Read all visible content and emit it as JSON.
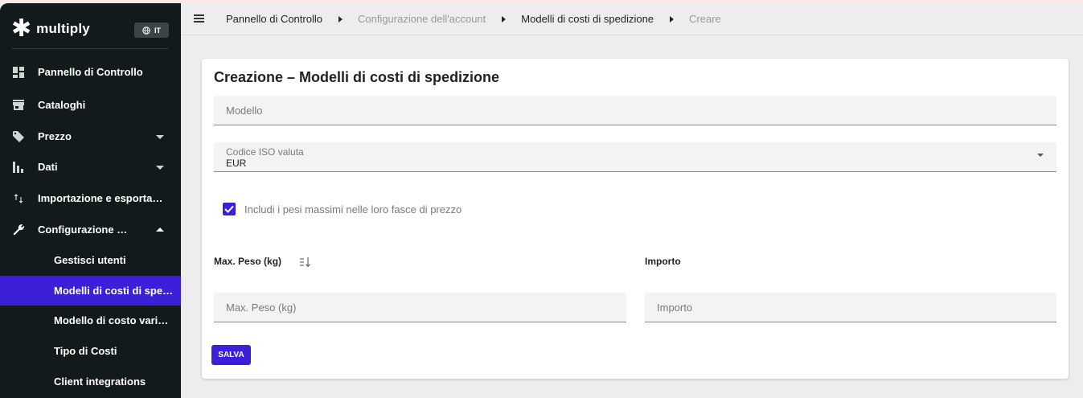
{
  "brand": {
    "name": "multiply",
    "star": "✱",
    "language_code": "IT"
  },
  "sidebar": {
    "items": [
      {
        "label": "Pannello di Controllo",
        "icon": "dashboard-icon"
      },
      {
        "label": "Cataloghi",
        "icon": "store-icon"
      },
      {
        "label": "Prezzo",
        "icon": "tag-icon",
        "expand": "collapsed"
      },
      {
        "label": "Dati",
        "icon": "bar-chart-icon",
        "expand": "collapsed"
      },
      {
        "label": "Importazione e esportazione",
        "icon": "import-export-icon"
      },
      {
        "label": "Configurazione dell'account",
        "icon": "wrench-icon",
        "expand": "expanded"
      }
    ],
    "subitems": [
      {
        "label": "Gestisci utenti"
      },
      {
        "label": "Modelli di costi di spedizione",
        "active": true
      },
      {
        "label": "Modello di costo variabile"
      },
      {
        "label": "Tipo di Costi"
      },
      {
        "label": "Client integrations"
      }
    ]
  },
  "breadcrumb": [
    {
      "label": "Pannello di Controllo",
      "muted": false
    },
    {
      "label": "Configurazione dell'account",
      "muted": true
    },
    {
      "label": "Modelli di costi di spedizione",
      "muted": false
    },
    {
      "label": "Creare",
      "muted": true
    }
  ],
  "form": {
    "title": "Creazione – Modelli di costi di spedizione",
    "model": {
      "placeholder": "Modello",
      "value": ""
    },
    "currency": {
      "label": "Codice ISO valuta",
      "value": "EUR"
    },
    "checkbox": {
      "label": "Includi i pesi massimi nelle loro fasce di prezzo",
      "checked": true
    },
    "table": {
      "weight_header": "Max. Peso (kg)",
      "amount_header": "Importo",
      "weight_placeholder": "Max. Peso (kg)",
      "amount_placeholder": "Importo"
    },
    "save_label": "SALVA"
  },
  "colors": {
    "accent": "#3c1fd9",
    "sidebar_bg": "#121a1c",
    "page_bg": "#ededed"
  }
}
